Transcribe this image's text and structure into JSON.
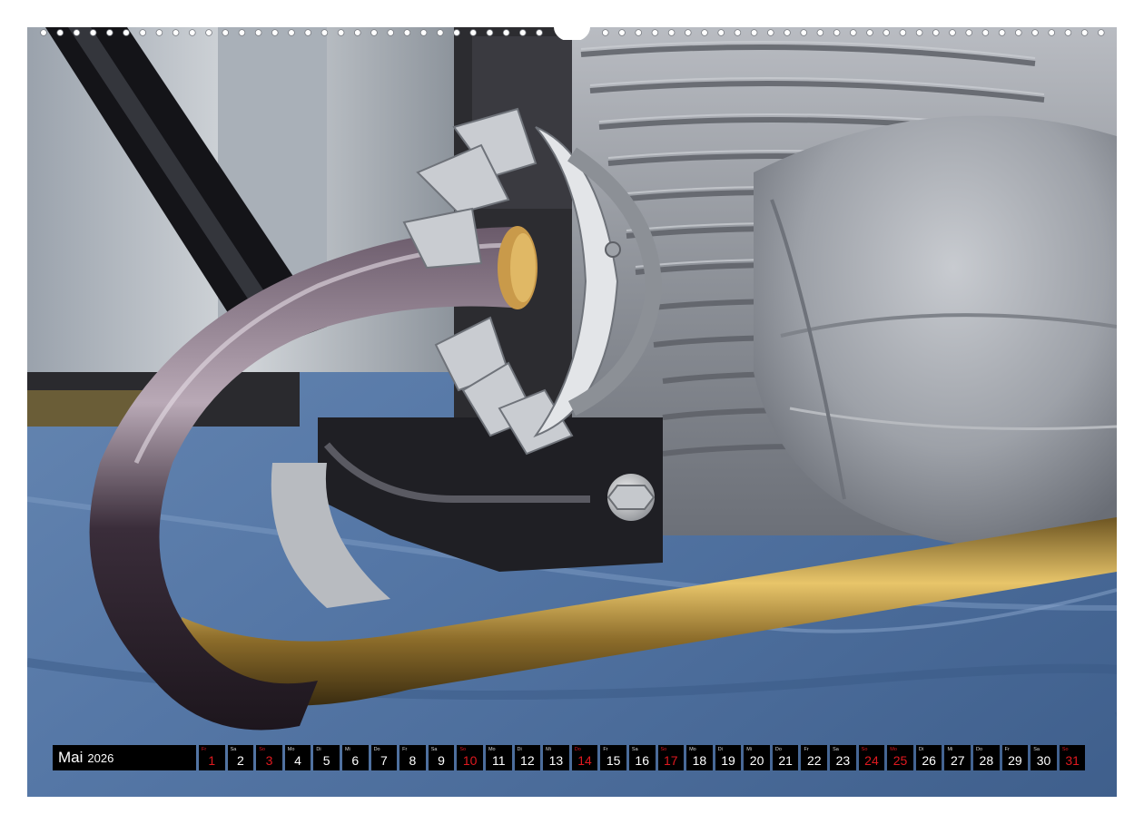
{
  "calendar": {
    "month": "Mai",
    "year": "2026",
    "days": [
      {
        "wd": "Fr",
        "num": "1",
        "red": true
      },
      {
        "wd": "Sa",
        "num": "2",
        "red": false
      },
      {
        "wd": "So",
        "num": "3",
        "red": true
      },
      {
        "wd": "Mo",
        "num": "4",
        "red": false
      },
      {
        "wd": "Di",
        "num": "5",
        "red": false
      },
      {
        "wd": "Mi",
        "num": "6",
        "red": false
      },
      {
        "wd": "Do",
        "num": "7",
        "red": false
      },
      {
        "wd": "Fr",
        "num": "8",
        "red": false
      },
      {
        "wd": "Sa",
        "num": "9",
        "red": false
      },
      {
        "wd": "So",
        "num": "10",
        "red": true
      },
      {
        "wd": "Mo",
        "num": "11",
        "red": false
      },
      {
        "wd": "Di",
        "num": "12",
        "red": false
      },
      {
        "wd": "Mi",
        "num": "13",
        "red": false
      },
      {
        "wd": "Do",
        "num": "14",
        "red": true
      },
      {
        "wd": "Fr",
        "num": "15",
        "red": false
      },
      {
        "wd": "Sa",
        "num": "16",
        "red": false
      },
      {
        "wd": "So",
        "num": "17",
        "red": true
      },
      {
        "wd": "Mo",
        "num": "18",
        "red": false
      },
      {
        "wd": "Di",
        "num": "19",
        "red": false
      },
      {
        "wd": "Mi",
        "num": "20",
        "red": false
      },
      {
        "wd": "Do",
        "num": "21",
        "red": false
      },
      {
        "wd": "Fr",
        "num": "22",
        "red": false
      },
      {
        "wd": "Sa",
        "num": "23",
        "red": false
      },
      {
        "wd": "So",
        "num": "24",
        "red": true
      },
      {
        "wd": "Mo",
        "num": "25",
        "red": true
      },
      {
        "wd": "Di",
        "num": "26",
        "red": false
      },
      {
        "wd": "Mi",
        "num": "27",
        "red": false
      },
      {
        "wd": "Do",
        "num": "28",
        "red": false
      },
      {
        "wd": "Fr",
        "num": "29",
        "red": false
      },
      {
        "wd": "Sa",
        "num": "30",
        "red": false
      },
      {
        "wd": "So",
        "num": "31",
        "red": true
      }
    ]
  },
  "colors": {
    "strip_bg": "#000000",
    "holiday_red": "#e0191f",
    "cloth_blue": "#4e6e9a"
  }
}
